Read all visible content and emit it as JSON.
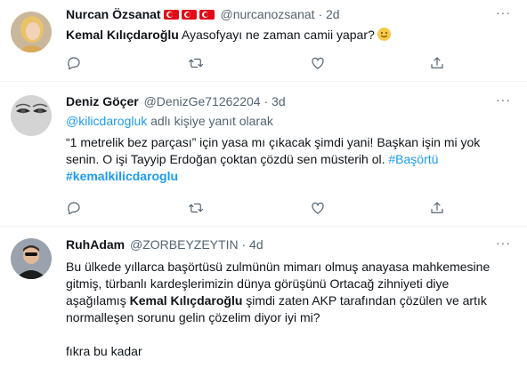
{
  "tweets": [
    {
      "name": "Nurcan Özsanat",
      "handle": "@nurcanozsanat",
      "sep": "·",
      "time": "2d",
      "mention_bold": "Kemal Kılıçdaroğlu",
      "text": " Ayasofyayı ne zaman camii yapar?",
      "emoji": "smiling-face"
    },
    {
      "name": "Deniz Göçer",
      "handle": "@DenizGe71262204",
      "sep": "·",
      "time": "3d",
      "reply_handle": "@kilicdarogluk",
      "reply_suffix": " adlı kişiye yanıt olarak",
      "line1": "“1 metrelik bez parçası”  için yasa mı çıkacak  şimdi yani! Başkan işin mi yok",
      "line2": "senin. O işi Tayyip Erdoğan çoktan çözdü sen müsterih ol. ",
      "hashtag1": "#Başörtü",
      "hashtag2": "#kemalkilicdaroglu"
    },
    {
      "name": "RuhAdam",
      "handle": "@ZORBEYZEYTIN",
      "sep": "·",
      "time": "4d",
      "line1": "Bu ülkede yıllarca başörtüsü zulmünün mimarı olmuş anayasa mahkemesine",
      "line2": "gitmiş, türbanlı kardeşlerimizin dünya görüşünü Ortacağ zihniyeti diye",
      "line3_pre": "aşağılamış ",
      "line3_bold": "Kemal Kılıçdaroğlu",
      "line3_post": " şimdi zaten AKP tarafından çözülen ve artık",
      "line4": "normalleşen sorunu gelin çözelim diyor iyi mi?",
      "line5": "fıkra bu kadar"
    }
  ],
  "more_label": "···",
  "icons": [
    "reply-icon",
    "retweet-icon",
    "like-icon",
    "share-icon"
  ],
  "colors": {
    "link": "#1d9bf0",
    "muted": "#536471",
    "text": "#0f1419",
    "flag": "#e30a17"
  }
}
